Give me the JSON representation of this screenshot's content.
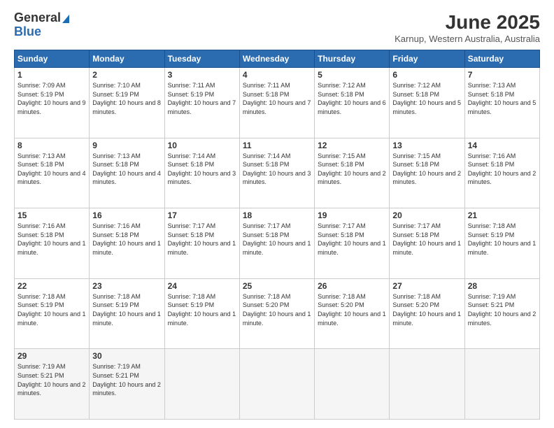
{
  "logo": {
    "general": "General",
    "blue": "Blue"
  },
  "title": "June 2025",
  "location": "Karnup, Western Australia, Australia",
  "weekdays": [
    "Sunday",
    "Monday",
    "Tuesday",
    "Wednesday",
    "Thursday",
    "Friday",
    "Saturday"
  ],
  "weeks": [
    [
      {
        "day": "1",
        "sunrise": "7:09 AM",
        "sunset": "5:19 PM",
        "daylight": "10 hours and 9 minutes."
      },
      {
        "day": "2",
        "sunrise": "7:10 AM",
        "sunset": "5:19 PM",
        "daylight": "10 hours and 8 minutes."
      },
      {
        "day": "3",
        "sunrise": "7:11 AM",
        "sunset": "5:19 PM",
        "daylight": "10 hours and 7 minutes."
      },
      {
        "day": "4",
        "sunrise": "7:11 AM",
        "sunset": "5:18 PM",
        "daylight": "10 hours and 7 minutes."
      },
      {
        "day": "5",
        "sunrise": "7:12 AM",
        "sunset": "5:18 PM",
        "daylight": "10 hours and 6 minutes."
      },
      {
        "day": "6",
        "sunrise": "7:12 AM",
        "sunset": "5:18 PM",
        "daylight": "10 hours and 5 minutes."
      },
      {
        "day": "7",
        "sunrise": "7:13 AM",
        "sunset": "5:18 PM",
        "daylight": "10 hours and 5 minutes."
      }
    ],
    [
      {
        "day": "8",
        "sunrise": "7:13 AM",
        "sunset": "5:18 PM",
        "daylight": "10 hours and 4 minutes."
      },
      {
        "day": "9",
        "sunrise": "7:13 AM",
        "sunset": "5:18 PM",
        "daylight": "10 hours and 4 minutes."
      },
      {
        "day": "10",
        "sunrise": "7:14 AM",
        "sunset": "5:18 PM",
        "daylight": "10 hours and 3 minutes."
      },
      {
        "day": "11",
        "sunrise": "7:14 AM",
        "sunset": "5:18 PM",
        "daylight": "10 hours and 3 minutes."
      },
      {
        "day": "12",
        "sunrise": "7:15 AM",
        "sunset": "5:18 PM",
        "daylight": "10 hours and 2 minutes."
      },
      {
        "day": "13",
        "sunrise": "7:15 AM",
        "sunset": "5:18 PM",
        "daylight": "10 hours and 2 minutes."
      },
      {
        "day": "14",
        "sunrise": "7:16 AM",
        "sunset": "5:18 PM",
        "daylight": "10 hours and 2 minutes."
      }
    ],
    [
      {
        "day": "15",
        "sunrise": "7:16 AM",
        "sunset": "5:18 PM",
        "daylight": "10 hours and 1 minute."
      },
      {
        "day": "16",
        "sunrise": "7:16 AM",
        "sunset": "5:18 PM",
        "daylight": "10 hours and 1 minute."
      },
      {
        "day": "17",
        "sunrise": "7:17 AM",
        "sunset": "5:18 PM",
        "daylight": "10 hours and 1 minute."
      },
      {
        "day": "18",
        "sunrise": "7:17 AM",
        "sunset": "5:18 PM",
        "daylight": "10 hours and 1 minute."
      },
      {
        "day": "19",
        "sunrise": "7:17 AM",
        "sunset": "5:18 PM",
        "daylight": "10 hours and 1 minute."
      },
      {
        "day": "20",
        "sunrise": "7:17 AM",
        "sunset": "5:18 PM",
        "daylight": "10 hours and 1 minute."
      },
      {
        "day": "21",
        "sunrise": "7:18 AM",
        "sunset": "5:19 PM",
        "daylight": "10 hours and 1 minute."
      }
    ],
    [
      {
        "day": "22",
        "sunrise": "7:18 AM",
        "sunset": "5:19 PM",
        "daylight": "10 hours and 1 minute."
      },
      {
        "day": "23",
        "sunrise": "7:18 AM",
        "sunset": "5:19 PM",
        "daylight": "10 hours and 1 minute."
      },
      {
        "day": "24",
        "sunrise": "7:18 AM",
        "sunset": "5:19 PM",
        "daylight": "10 hours and 1 minute."
      },
      {
        "day": "25",
        "sunrise": "7:18 AM",
        "sunset": "5:20 PM",
        "daylight": "10 hours and 1 minute."
      },
      {
        "day": "26",
        "sunrise": "7:18 AM",
        "sunset": "5:20 PM",
        "daylight": "10 hours and 1 minute."
      },
      {
        "day": "27",
        "sunrise": "7:18 AM",
        "sunset": "5:20 PM",
        "daylight": "10 hours and 1 minute."
      },
      {
        "day": "28",
        "sunrise": "7:19 AM",
        "sunset": "5:21 PM",
        "daylight": "10 hours and 2 minutes."
      }
    ],
    [
      {
        "day": "29",
        "sunrise": "7:19 AM",
        "sunset": "5:21 PM",
        "daylight": "10 hours and 2 minutes."
      },
      {
        "day": "30",
        "sunrise": "7:19 AM",
        "sunset": "5:21 PM",
        "daylight": "10 hours and 2 minutes."
      },
      null,
      null,
      null,
      null,
      null
    ]
  ]
}
